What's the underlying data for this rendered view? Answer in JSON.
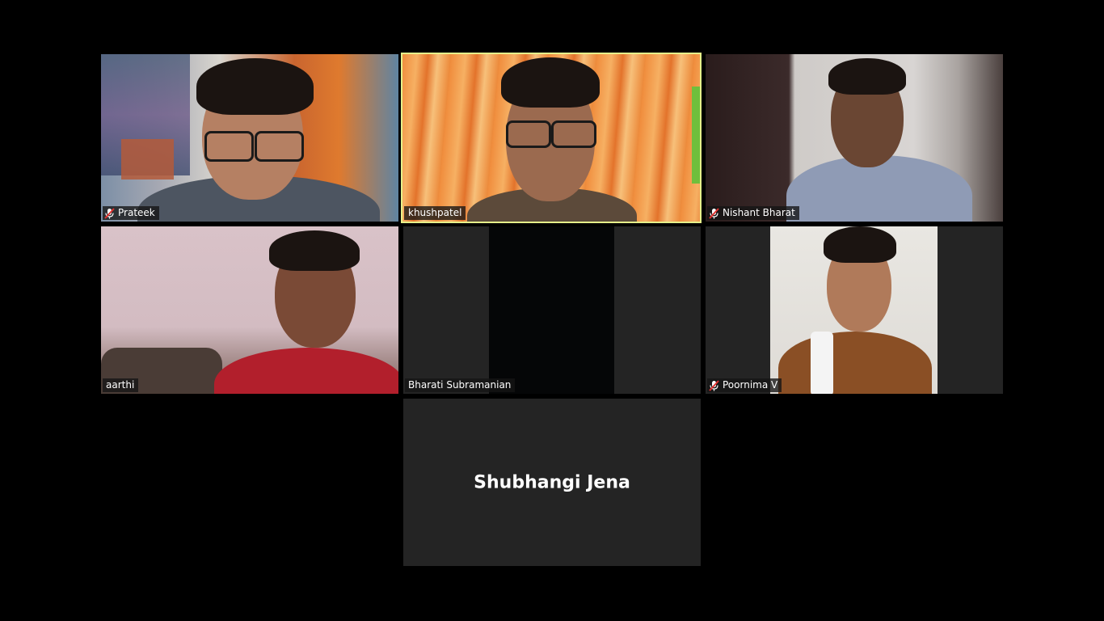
{
  "participants": [
    {
      "name": "Prateek",
      "muted": true,
      "active": false
    },
    {
      "name": "khushpatel",
      "muted": false,
      "active": true
    },
    {
      "name": "Nishant Bharat",
      "muted": true,
      "active": false
    },
    {
      "name": "aarthi",
      "muted": false,
      "active": false
    },
    {
      "name": "Bharati Subramanian",
      "muted": false,
      "active": false
    },
    {
      "name": "Poornima V",
      "muted": true,
      "active": false
    },
    {
      "name": "Shubhangi Jena",
      "muted": false,
      "active": false,
      "video_off": true
    }
  ],
  "colors": {
    "background": "#000000",
    "tile_empty": "#242424",
    "active_speaker_border": "#e6f08a",
    "mute_icon": "#e0322f"
  },
  "icons": {
    "muted": "microphone-muted-icon"
  }
}
